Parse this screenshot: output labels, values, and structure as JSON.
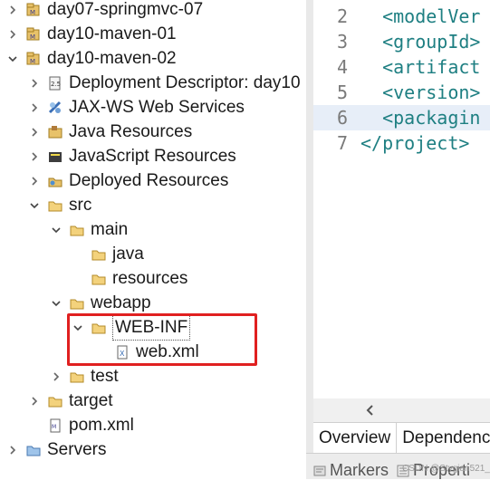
{
  "tree": {
    "items": [
      {
        "label": "day07-springmvc-07",
        "expanded": false,
        "icon": "maven-project-icon"
      },
      {
        "label": "day10-maven-01",
        "expanded": false,
        "icon": "maven-project-icon"
      },
      {
        "label": "day10-maven-02",
        "expanded": true,
        "icon": "maven-project-icon"
      },
      {
        "label": "Deployment Descriptor: day10",
        "expanded": false,
        "icon": "deployment-descriptor-icon"
      },
      {
        "label": "JAX-WS Web Services",
        "expanded": false,
        "icon": "web-services-icon"
      },
      {
        "label": "Java Resources",
        "expanded": false,
        "icon": "java-resources-icon"
      },
      {
        "label": "JavaScript Resources",
        "expanded": false,
        "icon": "javascript-resources-icon"
      },
      {
        "label": "Deployed Resources",
        "expanded": false,
        "icon": "deployed-resources-icon"
      },
      {
        "label": "src",
        "expanded": true,
        "icon": "folder-icon"
      },
      {
        "label": "main",
        "expanded": true,
        "icon": "folder-icon"
      },
      {
        "label": "java",
        "icon": "folder-icon"
      },
      {
        "label": "resources",
        "icon": "folder-icon"
      },
      {
        "label": "webapp",
        "expanded": true,
        "icon": "folder-icon"
      },
      {
        "label": "WEB-INF",
        "expanded": true,
        "icon": "folder-icon"
      },
      {
        "label": "web.xml",
        "icon": "xml-file-icon"
      },
      {
        "label": "test",
        "expanded": false,
        "icon": "folder-icon"
      },
      {
        "label": "target",
        "expanded": false,
        "icon": "folder-icon"
      },
      {
        "label": "pom.xml",
        "icon": "pom-file-icon"
      },
      {
        "label": "Servers",
        "expanded": false,
        "icon": "servers-folder-icon"
      }
    ]
  },
  "editor": {
    "lines": [
      {
        "num": "2",
        "text": "  <modelVer"
      },
      {
        "num": "3",
        "text": "  <groupId>"
      },
      {
        "num": "4",
        "text": "  <artifact"
      },
      {
        "num": "5",
        "text": "  <version>"
      },
      {
        "num": "6",
        "text": "  <packagin"
      },
      {
        "num": "7",
        "text": "</project>"
      }
    ],
    "tabs": [
      "Overview",
      "Dependenci"
    ]
  },
  "views": {
    "tabs": [
      "Markers",
      "Properti"
    ]
  },
  "watermark": "CSDN @Stygian521_Spurt",
  "colors": {
    "highlight": "#e02020",
    "tag": "#1e7f82"
  }
}
